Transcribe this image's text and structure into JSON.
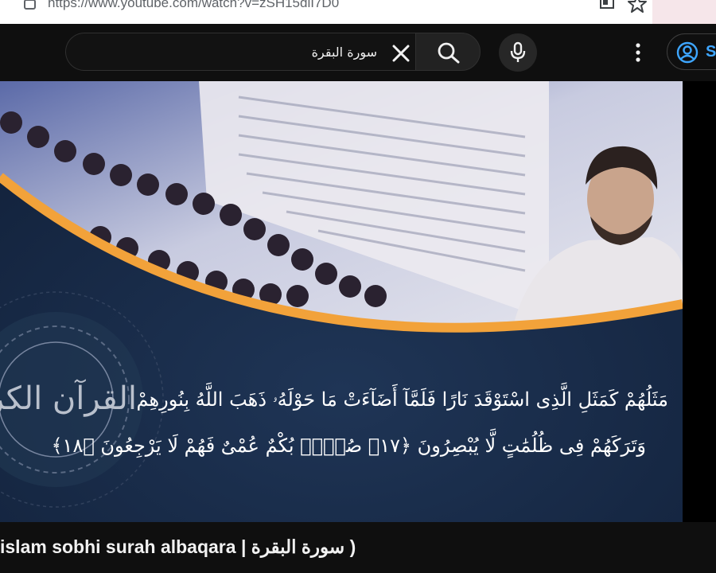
{
  "browser": {
    "url": "https://www.youtube.com/watch?v=zSH15dlI7D0"
  },
  "masthead": {
    "search": {
      "value": "سورة البقرة"
    },
    "signin_label": "S"
  },
  "player": {
    "ayah_lines": [
      "مَثَلُهُمْ كَمَثَلِ الَّذِى اسْتَوْقَدَ نَارًا فَلَمَّآ أَضَآءَتْ مَا حَوْلَهُۥ ذَهَبَ اللَّهُ بِنُورِهِمْ",
      "وَتَرَكَهُمْ فِى ظُلُمَٰتٍ لَّا يُبْصِرُونَ ﴿١٧﴾ صُمٌّۢ بُكْمٌ عُمْىٌ فَهُمْ لَا يَرْجِعُونَ ﴿١٨﴾"
    ],
    "calligraphy_text": "القرآن الكريم"
  },
  "video": {
    "title": "( سورة البقرة | islam sobhi surah albaqara"
  },
  "colors": {
    "youtube_bg": "#0f0f0f",
    "link_blue": "#3ea6ff",
    "accent_orange": "#f2a23a",
    "player_navy": "#1a2b47"
  }
}
